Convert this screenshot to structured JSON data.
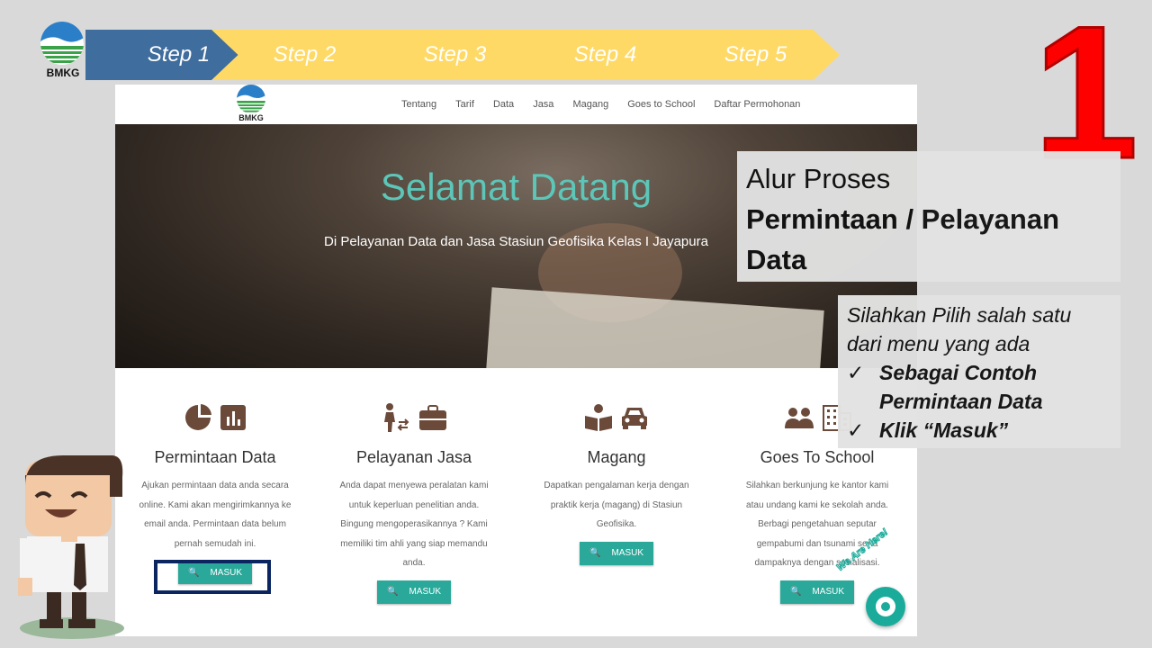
{
  "brand": {
    "name": "BMKG"
  },
  "steps": [
    "Step 1",
    "Step 2",
    "Step 3",
    "Step 4",
    "Step 5"
  ],
  "step_number": "1",
  "site": {
    "logo_text": "BMKG",
    "menu": [
      "Tentang",
      "Tarif",
      "Data",
      "Jasa",
      "Magang",
      "Goes to School",
      "Daftar Permohonan"
    ],
    "hero": {
      "title": "Selamat Datang",
      "subtitle": "Di Pelayanan Data dan Jasa Stasiun Geofisika Kelas I Jayapura"
    },
    "cards": [
      {
        "title": "Permintaan Data",
        "text": "Ajukan permintaan data anda secara online. Kami akan mengirimkannya ke email anda. Permintaan data belum pernah semudah ini.",
        "button": "MASUK"
      },
      {
        "title": "Pelayanan Jasa",
        "text": "Anda dapat menyewa peralatan kami untuk keperluan penelitian anda. Bingung mengoperasikannya ? Kami memiliki tim ahli yang siap memandu anda.",
        "button": "MASUK"
      },
      {
        "title": "Magang",
        "text": "Dapatkan pengalaman kerja dengan praktik kerja (magang) di Stasiun Geofisika.",
        "button": "MASUK"
      },
      {
        "title": "Goes To School",
        "text": "Silahkan berkunjung ke kantor kami atau undang kami ke sekolah anda. Berbagi pengetahuan seputar gempabumi dan tsunami serta dampaknya dengan sosialisasi.",
        "button": "MASUK"
      }
    ],
    "chat_badge": "We Are Here!"
  },
  "panel_title": {
    "line1": "Alur Proses",
    "line2": "Permintaan / Pelayanan",
    "line3": "Data"
  },
  "panel_instructions": {
    "line1": "Silahkan Pilih salah satu",
    "line2": "dari menu yang ada",
    "item1a": "Sebagai Contoh",
    "item1b": "Permintaan Data",
    "item2": "Klik “Masuk”",
    "check": "✓"
  },
  "colors": {
    "step_active": "#3f6d9d",
    "step_inactive": "#ffd966",
    "accent": "#2aa99a",
    "highlight_box": "#0b2560",
    "big_number": "#ff0000"
  }
}
